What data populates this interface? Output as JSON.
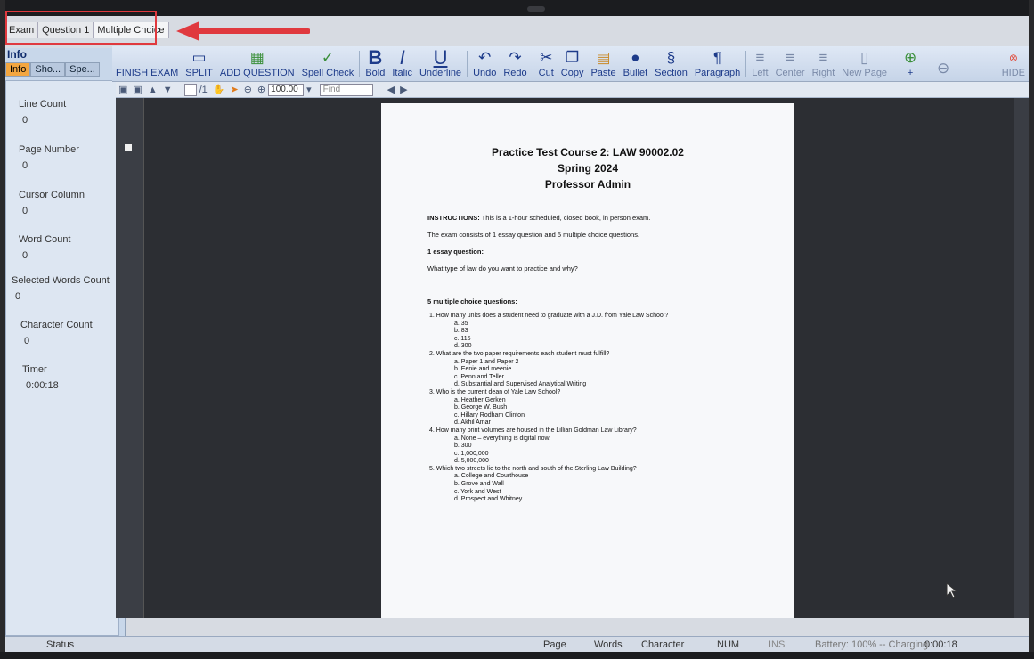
{
  "doc_tabs": [
    "Exam",
    "Question 1",
    "Multiple Choice"
  ],
  "info_panel": {
    "title": "Info",
    "pin": "⇩",
    "tabs": [
      "Info",
      "Sho...",
      "Spe..."
    ],
    "stats": [
      {
        "label": "Line Count",
        "value": "0"
      },
      {
        "label": "Page Number",
        "value": "0"
      },
      {
        "label": "Cursor Column",
        "value": "0"
      },
      {
        "label": "Word Count",
        "value": "0"
      },
      {
        "label": "Selected Words Count",
        "value": "0"
      },
      {
        "label": "Character Count",
        "value": "0"
      },
      {
        "label": "Timer",
        "value": "0:00:18"
      }
    ]
  },
  "toolbar": {
    "finish_exam": "FINISH EXAM",
    "split": "SPLIT",
    "add_question": "ADD QUESTION",
    "spell_check": "Spell Check",
    "bold": "Bold",
    "italic": "Italic",
    "underline": "Underline",
    "undo": "Undo",
    "redo": "Redo",
    "cut": "Cut",
    "copy": "Copy",
    "paste": "Paste",
    "bullet": "Bullet",
    "section": "Section",
    "paragraph": "Paragraph",
    "left": "Left",
    "center": "Center",
    "right": "Right",
    "new_page": "New Page",
    "zoom_in": "+",
    "hide": "HIDE"
  },
  "navbar": {
    "page_of": "/1",
    "zoom": "100.00",
    "find_placeholder": "Find"
  },
  "document": {
    "title": "Practice Test Course 2: LAW 90002.02",
    "term": "Spring 2024",
    "professor": "Professor Admin",
    "instructions_label": "INSTRUCTIONS:",
    "instructions_text": "This is a 1-hour scheduled, closed book, in person exam.",
    "consists": "The exam consists of 1 essay question and 5 multiple choice questions.",
    "essay_heading": "1 essay question:",
    "essay_q": "What type of law do you want to practice and why?",
    "mc_heading": "5 multiple choice questions:",
    "questions": [
      {
        "q": "1.   How many units does a student need to graduate with a J.D. from Yale Law School?",
        "opts": [
          "a.   35",
          "b.   83",
          "c.   115",
          "d.   300"
        ]
      },
      {
        "q": "2.   What are the two paper requirements each student must fulfill?",
        "opts": [
          "a.   Paper 1 and Paper 2",
          "b.   Eenie and meenie",
          "c.   Penn and Teller",
          "d.   Substantial and Supervised Analytical Writing"
        ]
      },
      {
        "q": "3.   Who is the current dean of Yale Law School?",
        "opts": [
          "a.   Heather Gerken",
          "b.   George W. Bush",
          "c.   Hillary Rodham Clinton",
          "d.   Akhil Amar"
        ]
      },
      {
        "q": "4.   How many print volumes are housed in the Lillian Goldman Law Library?",
        "opts": [
          "a.   None – everything is digital now.",
          "b.   300",
          "c.   1,000,000",
          "d.   5,000,000"
        ]
      },
      {
        "q": "5.   Which two streets lie to the north and south of the Sterling Law Building?",
        "opts": [
          "a.   College and Courthouse",
          "b.   Grove and Wall",
          "c.   York and West",
          "d.   Prospect and Whitney"
        ]
      }
    ]
  },
  "status_bar": {
    "status": "Status",
    "page": "Page",
    "words": "Words",
    "character": "Character",
    "num": "NUM",
    "ins": "INS",
    "battery": "Battery: 100% -- Charging",
    "time": "0:00:18"
  },
  "colors": {
    "annotation": "#e0393e",
    "toolbar_text": "#1d3b8a",
    "active_tab": "#f3a640"
  }
}
